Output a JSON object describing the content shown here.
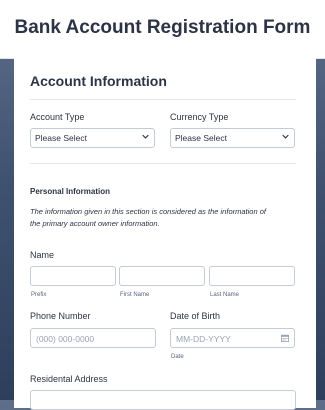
{
  "form": {
    "title": "Bank Account Registration Form"
  },
  "account_section": {
    "title": "Account Information",
    "account_type": {
      "label": "Account Type",
      "value": "Please Select"
    },
    "currency_type": {
      "label": "Currency Type",
      "value": "Please Select"
    }
  },
  "personal_section": {
    "title": "Personal Information",
    "description_line1": "The information given in this section is considered as the information of",
    "description_line2": "the primary account owner information.",
    "name": {
      "label": "Name",
      "prefix_label": "Prefix",
      "first_name_label": "First Name",
      "last_name_label": "Last Name"
    },
    "phone": {
      "label": "Phone Number",
      "placeholder": "(000) 000-0000"
    },
    "dob": {
      "label": "Date of Birth",
      "placeholder": "MM-DD-YYYY",
      "sublabel": "Date"
    },
    "address": {
      "label": "Residental Address"
    }
  },
  "icons": {
    "dropdown": "chevron-down-icon",
    "date": "calendar-icon"
  }
}
